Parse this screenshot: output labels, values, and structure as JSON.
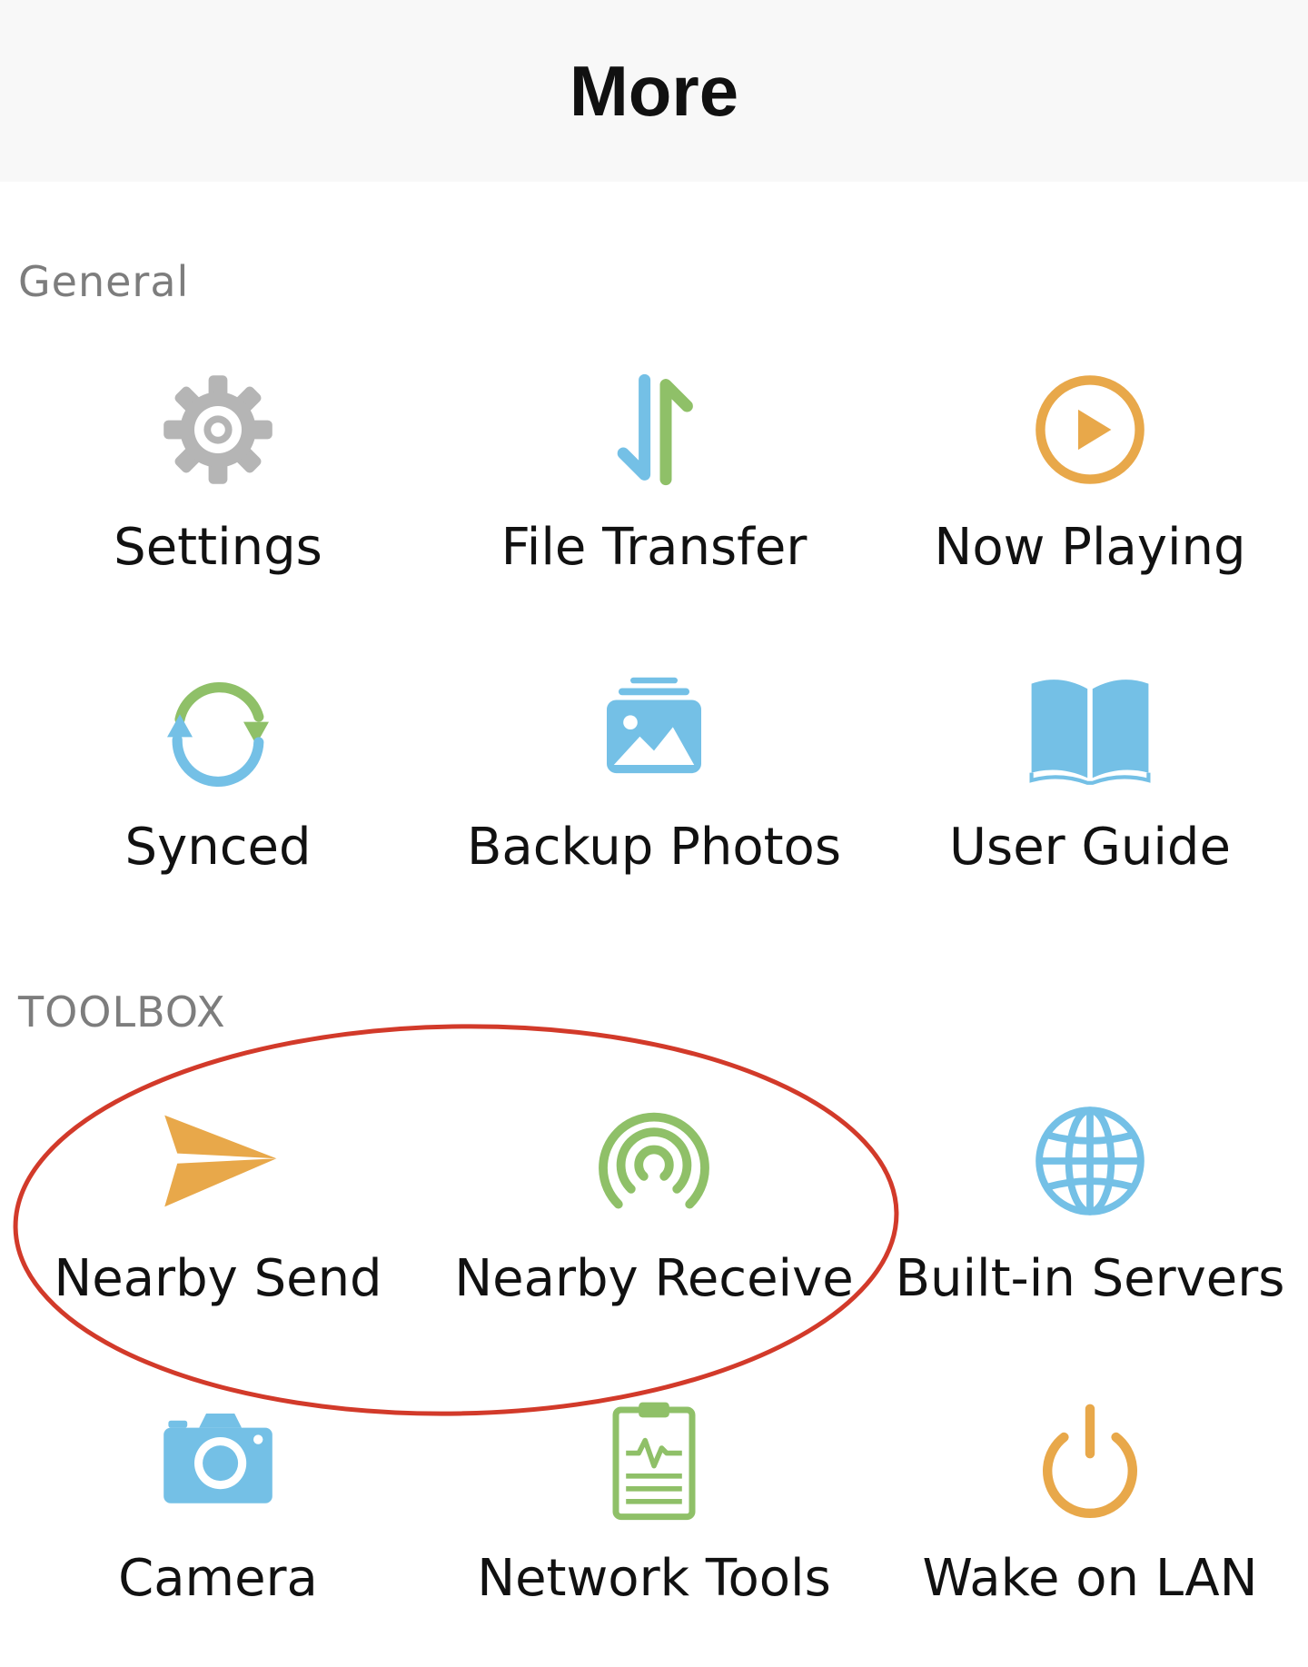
{
  "header": {
    "title": "More"
  },
  "sections": [
    {
      "title": "General",
      "items": [
        {
          "label": "Settings",
          "icon": "gear-icon",
          "color": "#b5b5b5"
        },
        {
          "label": "File Transfer",
          "icon": "transfer-arrows-icon",
          "color": "#74c0e6"
        },
        {
          "label": "Now Playing",
          "icon": "play-circle-icon",
          "color": "#e8a84a"
        },
        {
          "label": "Synced",
          "icon": "sync-icon",
          "color": "#8fc068"
        },
        {
          "label": "Backup Photos",
          "icon": "photo-stack-icon",
          "color": "#74c0e6"
        },
        {
          "label": "User Guide",
          "icon": "open-book-icon",
          "color": "#74c0e6"
        }
      ]
    },
    {
      "title": "TOOLBOX",
      "items": [
        {
          "label": "Nearby Send",
          "icon": "paper-plane-icon",
          "color": "#e8a84a"
        },
        {
          "label": "Nearby Receive",
          "icon": "radar-receive-icon",
          "color": "#8fc068"
        },
        {
          "label": "Built-in Servers",
          "icon": "globe-icon",
          "color": "#74c0e6"
        },
        {
          "label": "Camera",
          "icon": "camera-icon",
          "color": "#74c0e6"
        },
        {
          "label": "Network Tools",
          "icon": "clipboard-pulse-icon",
          "color": "#8fc068"
        },
        {
          "label": "Wake on LAN",
          "icon": "power-icon",
          "color": "#e8a84a"
        }
      ]
    }
  ],
  "annotation": {
    "highlight_color": "#d23a2a"
  }
}
